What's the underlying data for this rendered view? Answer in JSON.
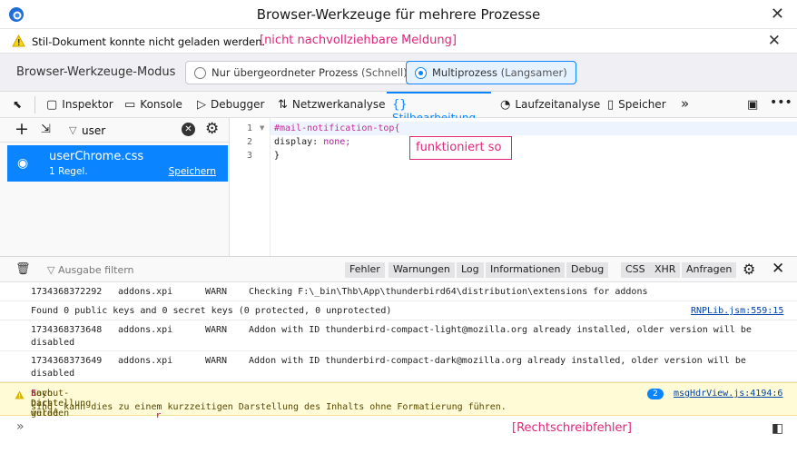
{
  "window": {
    "title": "Browser-Werkzeuge für mehrere Prozesse",
    "close": "✕"
  },
  "notice": {
    "message": "Stil-Dokument konnte nicht geladen werden.",
    "annotation": "[nicht nachvollziehbare Meldung]",
    "close": "✕"
  },
  "mode": {
    "label": "Browser-Werkzeuge-Modus",
    "option1": "Nur übergeordneter Prozess",
    "option1_sub": "(Schnell)",
    "option2": "Multiprozess",
    "option2_sub": "(Langsamer)",
    "selected": "option2"
  },
  "tabs": [
    {
      "label": "Inspektor",
      "icon": "inspector-icon"
    },
    {
      "label": "Konsole",
      "icon": "console-icon"
    },
    {
      "label": "Debugger",
      "icon": "debugger-icon"
    },
    {
      "label": "Netzwerkanalyse",
      "icon": "network-icon"
    },
    {
      "label": "Stilbearbeitung",
      "icon": "style-editor-icon",
      "active": true
    },
    {
      "label": "Laufzeitanalyse",
      "icon": "performance-icon"
    },
    {
      "label": "Speicher",
      "icon": "memory-icon"
    }
  ],
  "overflow": "»",
  "sidebar": {
    "filter_value": "user",
    "sheet": {
      "name": "userChrome.css",
      "rules": "1 Regel.",
      "save": "Speichern"
    }
  },
  "editor": {
    "lines": [
      "1",
      "2",
      "3"
    ],
    "code_line1": "#mail-notification-top{",
    "code_line2_prop": "display:",
    "code_line2_val": " none;",
    "code_line3": "}",
    "annotation": "funktioniert so"
  },
  "console": {
    "filter_placeholder": "Ausgabe filtern",
    "filters": [
      "Fehler",
      "Warnungen",
      "Log",
      "Informationen",
      "Debug",
      "CSS",
      "XHR",
      "Anfragen"
    ],
    "rows": [
      {
        "ts": "1734368372292",
        "mod": "addons.xpi",
        "lvl": "WARN",
        "text": "Checking F:\\_bin\\Thb\\App\\thunderbird64\\distribution\\extensions for addons"
      },
      {
        "text": "Found 0 public keys and 0 secret keys (0 protected, 0 unprotected)",
        "src": "RNPLib.jsm:559:15"
      },
      {
        "ts": "1734368373648",
        "mod": "addons.xpi",
        "lvl": "WARN",
        "text": "Addon with ID thunderbird-compact-light@mozilla.org already installed, older version will be",
        "text2": "disabled"
      },
      {
        "ts": "1734368373649",
        "mod": "addons.xpi",
        "lvl": "WARN",
        "text": "Addon with ID thunderbird-compact-dark@mozilla.org already installed, older version will be",
        "text2": "disabled"
      }
    ],
    "warning": {
      "text_a": "Layout-Darstellung wurde erzwungen, bevor die Seite vollständig geladen war. Falls Stylesheet",
      "mark_s": "S",
      "text_b": "noch nicht geladen",
      "text2": "sind, kann dies zu einem kurzzeitigen Darstellung des Inhalts ohne Formatierung führen.",
      "count": "2",
      "src": "msgHdrView.js:4194:6",
      "mark_r": "r"
    },
    "prompt": "»",
    "annotation": "[Rechtschreibfehler]"
  }
}
